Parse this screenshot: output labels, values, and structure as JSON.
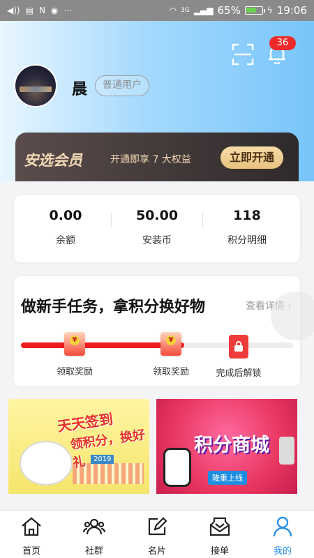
{
  "status_bar": {
    "icons": [
      "volume-icon",
      "sms-icon",
      "n-icon",
      "d-icon",
      "more-dots-icon",
      "wifi-icon",
      "signal-icon",
      "battery-icon",
      "charging-icon"
    ],
    "network": "3G",
    "battery": "65%",
    "battery_level": 0.65,
    "time": "19:06"
  },
  "header": {
    "notification_count": "36",
    "user_name": "晨",
    "user_tag": "普通用户"
  },
  "vip": {
    "title": "安选会员",
    "desc": "开通即享 7 大权益",
    "button": "立即开通"
  },
  "stats": [
    {
      "value": "0.00",
      "label": "余额"
    },
    {
      "value": "50.00",
      "label": "安装币"
    },
    {
      "value": "118",
      "label": "积分明细"
    }
  ],
  "task": {
    "title": "做新手任务，拿积分换好物",
    "more": "查看详情",
    "progress": 0.6,
    "steps": [
      {
        "label": "领取奖励",
        "icon": "red-envelope-icon"
      },
      {
        "label": "领取奖励",
        "icon": "red-envelope-icon"
      },
      {
        "label": "完成后解锁",
        "icon": "lock-icon"
      }
    ]
  },
  "banners": {
    "signin": {
      "line1": "天天签到",
      "line2": "领积分，换好礼",
      "year": "2019"
    },
    "mall": {
      "title": "积分商城",
      "subtitle": "隆重上线"
    }
  },
  "tabs": [
    {
      "label": "首页",
      "icon": "home-icon",
      "active": false
    },
    {
      "label": "社群",
      "icon": "community-icon",
      "active": false
    },
    {
      "label": "名片",
      "icon": "card-edit-icon",
      "active": false
    },
    {
      "label": "接单",
      "icon": "inbox-icon",
      "active": false
    },
    {
      "label": "我的",
      "icon": "user-icon",
      "active": true
    }
  ],
  "colors": {
    "accent": "#2a90e8",
    "red": "#ee1c1c",
    "gold": "#e8c27f"
  }
}
